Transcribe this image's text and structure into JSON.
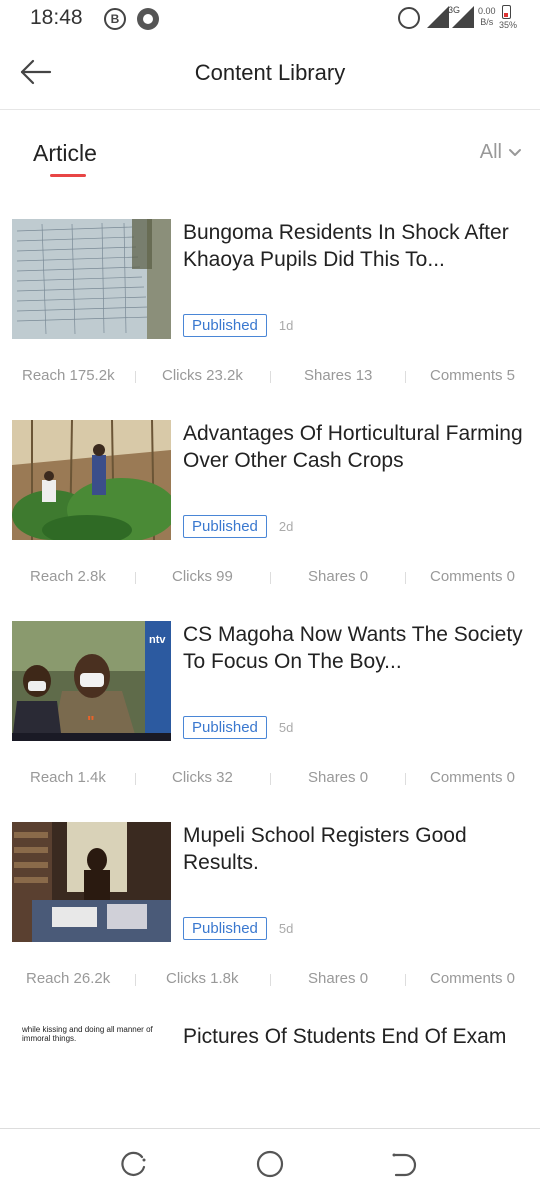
{
  "status_bar": {
    "time": "18:48",
    "network_type": "3G",
    "net_speed_value": "0.00",
    "net_speed_unit": "B/s",
    "battery_percent": "35%"
  },
  "header": {
    "title": "Content Library",
    "back_icon": "arrow-left-icon"
  },
  "tabs": {
    "active_label": "Article",
    "filter_label": "All",
    "accent_color": "#e84545"
  },
  "articles": [
    {
      "title": "Bungoma Residents In Shock After Khaoya Pupils Did This To...",
      "status": "Published",
      "age": "1d",
      "reach": "Reach 175.2k",
      "clicks": "Clicks 23.2k",
      "shares": "Shares 13",
      "comments": "Comments 5"
    },
    {
      "title": "Advantages Of Horticultural Farming Over Other Cash Crops",
      "status": "Published",
      "age": "2d",
      "reach": "Reach 2.8k",
      "clicks": "Clicks 99",
      "shares": "Shares 0",
      "comments": "Comments 0"
    },
    {
      "title": "CS Magoha Now Wants The Society To Focus On The Boy...",
      "status": "Published",
      "age": "5d",
      "reach": "Reach 1.4k",
      "clicks": "Clicks 32",
      "shares": "Shares 0",
      "comments": "Comments 0"
    },
    {
      "title": "Mupeli School Registers Good Results.",
      "status": "Published",
      "age": "5d",
      "reach": "Reach 26.2k",
      "clicks": "Clicks 1.8k",
      "shares": "Shares 0",
      "comments": "Comments 0"
    },
    {
      "title": "Pictures Of Students End Of Exam",
      "thumb_text": "while kissing and doing all manner of immoral things."
    }
  ],
  "colors": {
    "badge_blue": "#3a78cf",
    "stat_gray": "#999999"
  }
}
